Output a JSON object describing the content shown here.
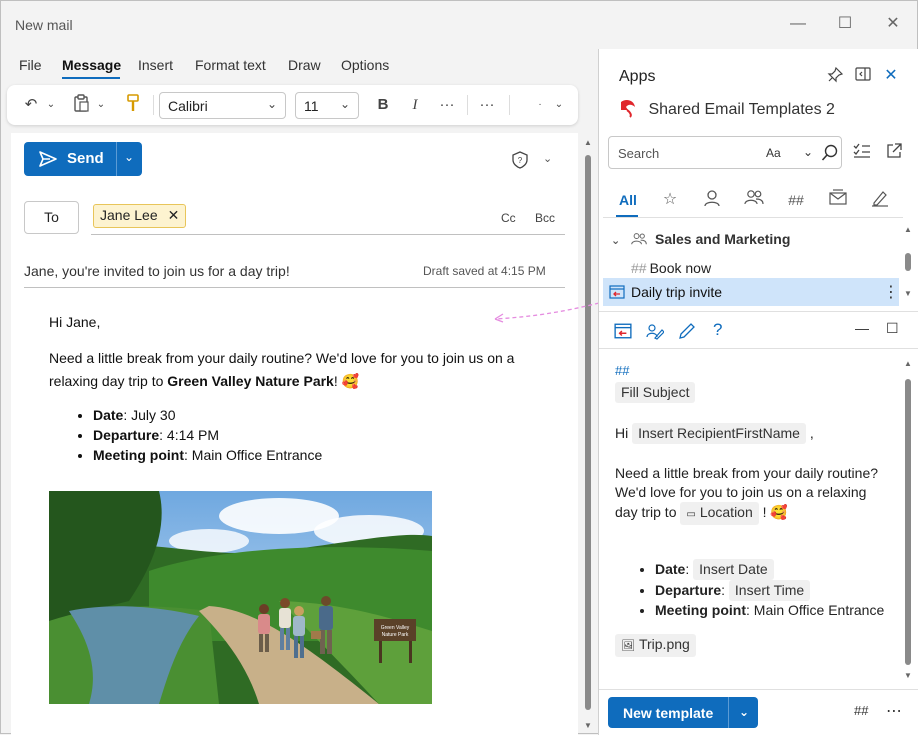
{
  "window": {
    "title": "New mail"
  },
  "menu": {
    "file": "File",
    "message": "Message",
    "insert": "Insert",
    "format_text": "Format text",
    "draw": "Draw",
    "options": "Options"
  },
  "ribbon": {
    "font": "Calibri",
    "size": "11",
    "bold": "B",
    "italic": "I",
    "more1": "···",
    "more2": "···"
  },
  "compose": {
    "send_label": "Send",
    "to_label": "To",
    "recipient": "Jane Lee",
    "cc": "Cc",
    "bcc": "Bcc",
    "subject": "Jane, you're invited to join us for a day trip!",
    "draft_status": "Draft saved at 4:15 PM",
    "greeting": "Hi Jane,",
    "intro_1": "Need a little break from your daily routine? We'd love for you to join us on a relaxing day trip to ",
    "intro_bold": "Green Valley Nature Park",
    "intro_end": "! 🥰",
    "bullets": [
      {
        "label": "Date",
        "value": " July 30"
      },
      {
        "label": "Departure",
        "value": " 4:14 PM"
      },
      {
        "label": "Meeting point",
        "value": " Main Office Entrance"
      }
    ],
    "sign_text": "Green Valley Nature Park Welcome"
  },
  "pane": {
    "title": "Apps",
    "addin_name": "Shared Email Templates 2",
    "search_placeholder": "Search",
    "search_case": "Aa",
    "tab_all": "All",
    "tab_hash": "##",
    "group_name": "Sales and Marketing",
    "item_book": "Book now",
    "item_book_prefix": "##",
    "item_selected": "Daily trip invite",
    "preview": {
      "hash": "##",
      "fill_subject": "Fill Subject",
      "hi": "Hi",
      "insert_first_name": "Insert RecipientFirstName",
      "comma": ",",
      "body_1": "Need a little break from your daily routine? We'd love for you to join us on a relaxing day trip to",
      "location": "Location",
      "body_end": "! 🥰",
      "date_label": "Date",
      "date_value": "Insert Date",
      "departure_label": "Departure",
      "departure_value": "Insert Time",
      "meeting_label": "Meeting point",
      "meeting_value": " Main Office Entrance",
      "attachment": "Trip.png"
    },
    "new_template": "New template",
    "footer_hash": "##"
  },
  "colors": {
    "accent": "#0f6cbd",
    "chip_bg": "#fdf3d0",
    "selected_bg": "#cfe4fa",
    "addin_logo": "#e0262c"
  }
}
